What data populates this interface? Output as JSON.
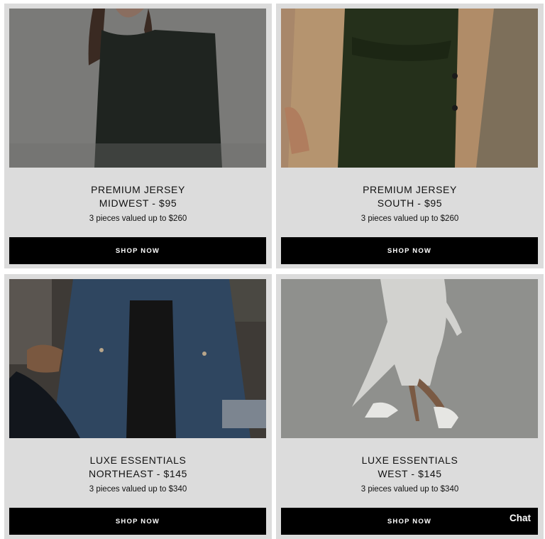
{
  "products": [
    {
      "title_line1": "PREMIUM JERSEY",
      "title_line2": "MIDWEST - $95",
      "subtitle": "3 pieces valued up to $260",
      "button": "SHOP NOW"
    },
    {
      "title_line1": "PREMIUM JERSEY",
      "title_line2": "SOUTH - $95",
      "subtitle": "3 pieces valued up to $260",
      "button": "SHOP NOW"
    },
    {
      "title_line1": "LUXE ESSENTIALS",
      "title_line2": "NORTHEAST - $145",
      "subtitle": "3 pieces valued up to $340",
      "button": "SHOP NOW"
    },
    {
      "title_line1": "LUXE ESSENTIALS",
      "title_line2": "WEST - $145",
      "subtitle": "3 pieces valued up to $340",
      "button": "SHOP NOW"
    }
  ],
  "chat": {
    "label": "Chat"
  },
  "colors": {
    "card_bg": "#dcdcdc",
    "button_bg": "#000000",
    "button_text": "#ffffff"
  }
}
